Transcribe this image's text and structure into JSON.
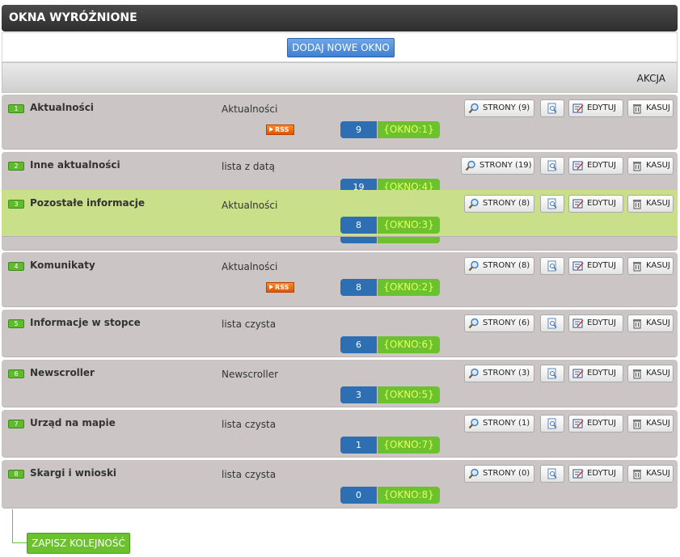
{
  "title": "OKNA WYRÓŻNIONE",
  "add_button": "DODAJ NOWE OKNO",
  "column_header": "AKCJA",
  "rss_label": "RSS",
  "buttons": {
    "edit": "EDYTUJ",
    "delete": "KASUJ"
  },
  "save_button": "ZAPISZ KOLEJNOŚĆ",
  "rows": [
    {
      "num": "1",
      "name": "Aktualności",
      "type": "Aktualności",
      "rss": true,
      "count": "9",
      "okno": "{OKNO:1}",
      "strony": "STRONY (9)"
    },
    {
      "num": "2",
      "name": "Inne aktualności",
      "type": "lista z datą",
      "rss": false,
      "count": "19",
      "okno": "{OKNO:4}",
      "strony": "STRONY (19)"
    },
    {
      "num": "3",
      "name": "Pozostałe informacje",
      "type": "Aktualności",
      "rss": false,
      "count": "8",
      "okno": "{OKNO:3}",
      "strony": "STRONY (8)"
    },
    {
      "num": "4",
      "name": "Komunikaty",
      "type": "Aktualności",
      "rss": true,
      "count": "8",
      "okno": "{OKNO:2}",
      "strony": "STRONY (8)"
    },
    {
      "num": "5",
      "name": "Informacje w stopce",
      "type": "lista czysta",
      "rss": false,
      "count": "6",
      "okno": "{OKNO:6}",
      "strony": "STRONY (6)"
    },
    {
      "num": "6",
      "name": "Newscroller",
      "type": "Newscroller",
      "rss": false,
      "count": "3",
      "okno": "{OKNO:5}",
      "strony": "STRONY (3)"
    },
    {
      "num": "7",
      "name": "Urząd na mapie",
      "type": "lista czysta",
      "rss": false,
      "count": "1",
      "okno": "{OKNO:7}",
      "strony": "STRONY (1)"
    },
    {
      "num": "8",
      "name": "Skargi i wnioski",
      "type": "lista czysta",
      "rss": false,
      "count": "0",
      "okno": "{OKNO:8}",
      "strony": "STRONY (0)"
    }
  ],
  "colors": {
    "count": "#2e6fb3",
    "okno": "#6cc22e",
    "okno_text": "#e7ff5a",
    "row": "#cbc6c5",
    "highlight": "#c9df8a"
  },
  "icons": {
    "strony": "magnifier-icon",
    "preview": "document-preview-icon",
    "edit": "edit-form-icon",
    "delete": "trash-icon",
    "rss": "rss-icon"
  }
}
